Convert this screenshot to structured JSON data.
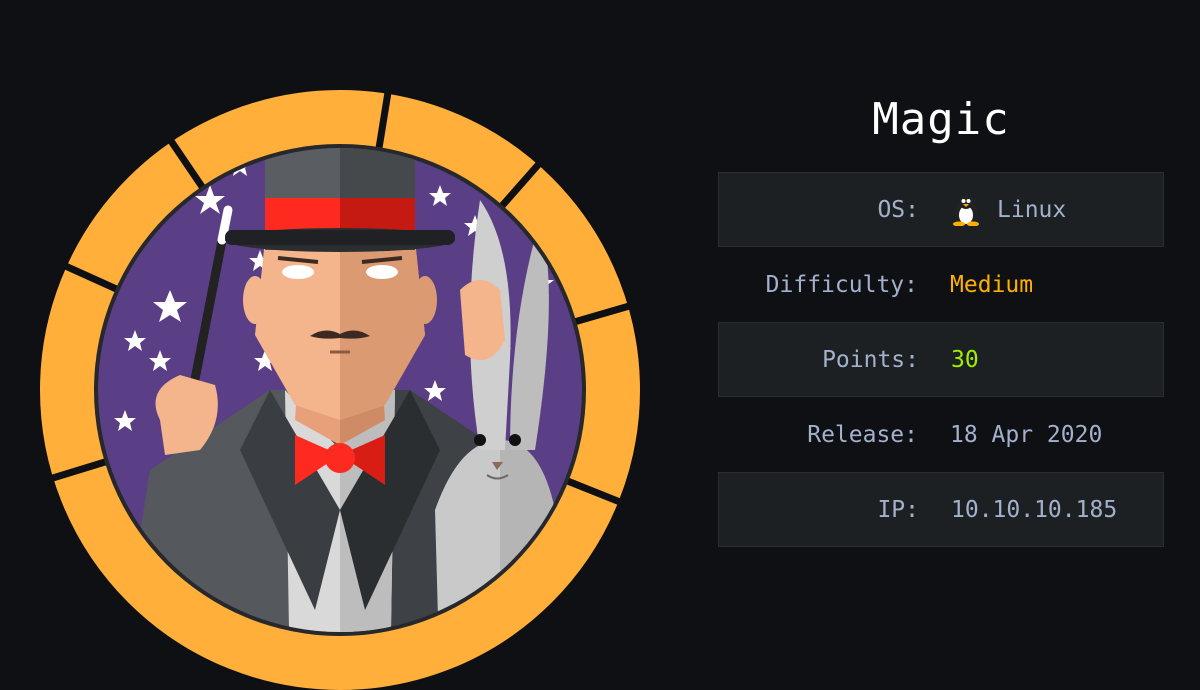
{
  "machine": {
    "name": "Magic",
    "os_label": "OS:",
    "os": "Linux",
    "os_icon": "linux-penguin-icon",
    "difficulty_label": "Difficulty:",
    "difficulty": "Medium",
    "points_label": "Points:",
    "points": "30",
    "release_label": "Release:",
    "release": "18 Apr 2020",
    "ip_label": "IP:",
    "ip": "10.10.10.185"
  },
  "colors": {
    "background": "#0f1013",
    "ring": "#ffaf3a",
    "medium": "#ffaf00",
    "points": "#9fef00",
    "label": "#a4b1cd",
    "row_shade": "#1d2023"
  }
}
